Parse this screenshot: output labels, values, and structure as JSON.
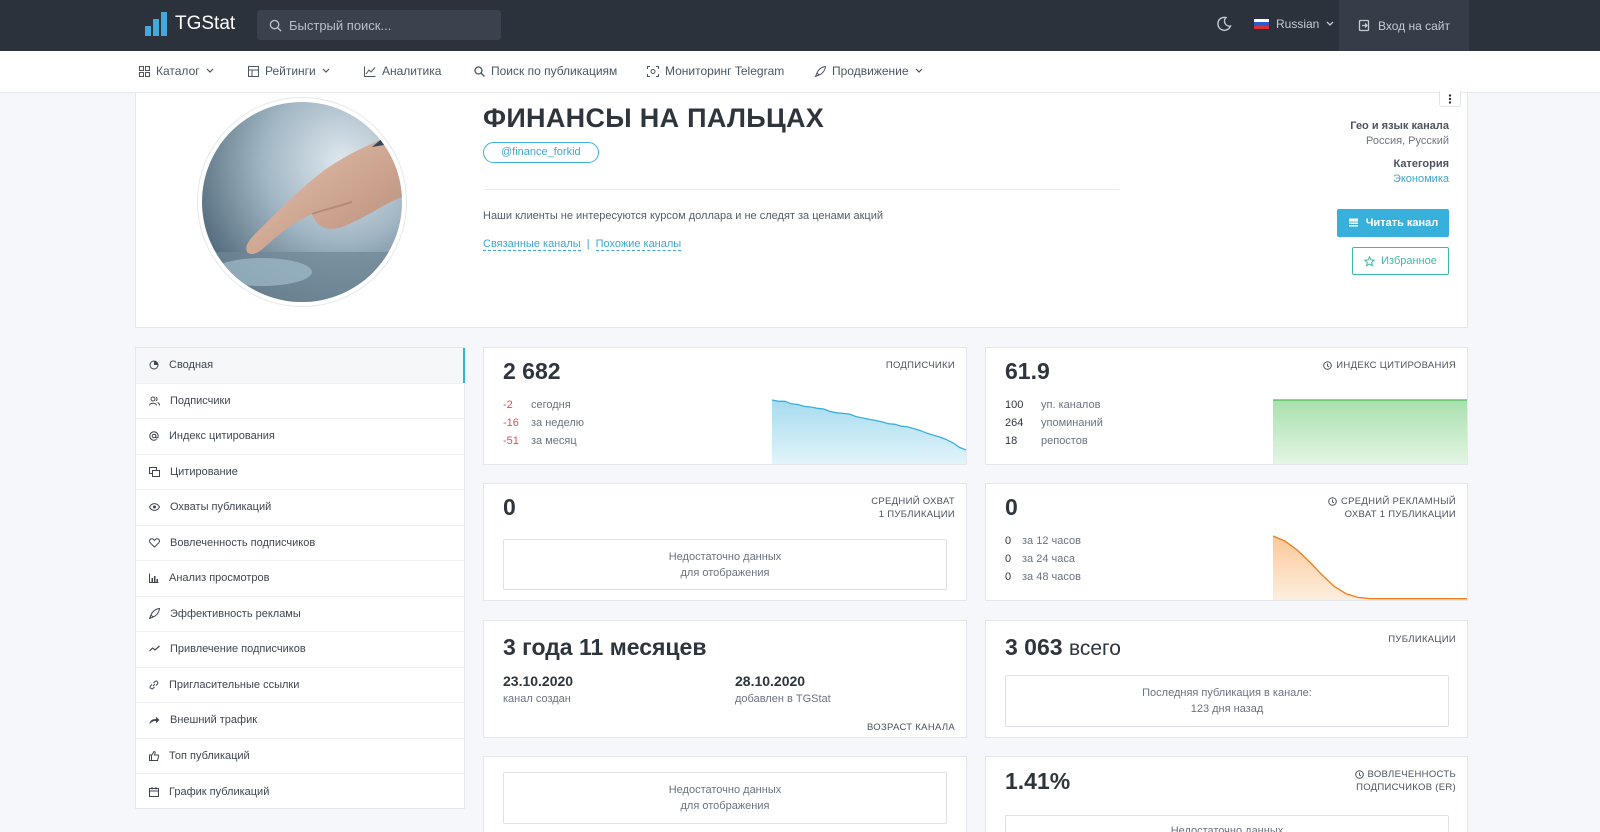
{
  "header": {
    "logo_text": "TGStat",
    "search_placeholder": "Быстрый поиск...",
    "language": "Russian",
    "login_label": "Вход на сайт"
  },
  "nav": [
    {
      "label": "Каталог",
      "icon": "grid-icon",
      "dropdown": true
    },
    {
      "label": "Рейтинги",
      "icon": "table-icon",
      "dropdown": true
    },
    {
      "label": "Аналитика",
      "icon": "chart-line-icon",
      "dropdown": false
    },
    {
      "label": "Поиск по публикациям",
      "icon": "search-icon",
      "dropdown": false
    },
    {
      "label": "Мониторинг Telegram",
      "icon": "monitor-icon",
      "dropdown": false
    },
    {
      "label": "Продвижение",
      "icon": "rocket-icon",
      "dropdown": true
    }
  ],
  "channel": {
    "title": "ФИНАНСЫ НА ПАЛЬЦАХ",
    "handle": "@finance_forkid",
    "description": "Наши клиенты не интересуются курсом доллара и не следят за ценами акций",
    "related_link": "Связанные каналы",
    "separator": "|",
    "similar_link": "Похожие каналы",
    "geo_label": "Гео и язык канала",
    "geo_value": "Россия, Русский",
    "category_label": "Категория",
    "category_value": "Экономика",
    "read_button": "Читать канал",
    "favorite_button": "Избранное"
  },
  "sidebar": [
    {
      "label": "Сводная",
      "icon": "summary-icon",
      "active": true
    },
    {
      "label": "Подписчики",
      "icon": "users-icon"
    },
    {
      "label": "Индекс цитирования",
      "icon": "at-icon"
    },
    {
      "label": "Цитирование",
      "icon": "quote-icon"
    },
    {
      "label": "Охваты публикаций",
      "icon": "eye-icon"
    },
    {
      "label": "Вовлеченность подписчиков",
      "icon": "heart-icon"
    },
    {
      "label": "Анализ просмотров",
      "icon": "bar-chart-icon"
    },
    {
      "label": "Эффективность рекламы",
      "icon": "rocket-icon"
    },
    {
      "label": "Привлечение подписчиков",
      "icon": "trend-icon"
    },
    {
      "label": "Пригласительные ссылки",
      "icon": "link-icon"
    },
    {
      "label": "Внешний трафик",
      "icon": "share-icon"
    },
    {
      "label": "Топ публикаций",
      "icon": "thumb-icon"
    },
    {
      "label": "График публикаций",
      "icon": "calendar-icon"
    }
  ],
  "stats": {
    "subscribers": {
      "value": "2 682",
      "label": "ПОДПИСЧИКИ",
      "rows": [
        {
          "n": "-2",
          "t": "сегодня"
        },
        {
          "n": "-16",
          "t": "за неделю"
        },
        {
          "n": "-51",
          "t": "за месяц"
        }
      ],
      "sparkline": [
        100,
        98,
        98,
        94,
        93,
        90,
        89,
        87,
        86,
        82,
        80,
        79,
        78,
        74,
        72,
        70,
        68,
        66,
        63,
        62,
        59,
        58,
        55,
        52,
        48,
        45,
        42,
        38,
        33,
        26,
        22
      ]
    },
    "citation": {
      "value": "61.9",
      "label": "ИНДЕКС ЦИТИРОВАНИЯ",
      "rows": [
        {
          "n": "100",
          "t": "уп. каналов"
        },
        {
          "n": "264",
          "t": "упоминаний"
        },
        {
          "n": "18",
          "t": "репостов"
        }
      ],
      "sparkline": [
        100,
        100,
        100,
        100,
        100,
        100,
        100,
        100,
        100,
        100,
        100,
        100
      ]
    },
    "avg_reach": {
      "value": "0",
      "label_line1": "СРЕДНИЙ ОХВАТ",
      "label_line2": "1 ПУБЛИКАЦИИ",
      "nodata_line1": "Недостаточно данных",
      "nodata_line2": "для отображения"
    },
    "ad_reach": {
      "value": "0",
      "label_line1": "СРЕДНИЙ РЕКЛАМНЫЙ",
      "label_line2": "ОХВАТ 1 ПУБЛИКАЦИИ",
      "rows": [
        {
          "n": "0",
          "t": "за 12 часов"
        },
        {
          "n": "0",
          "t": "за 24 часа"
        },
        {
          "n": "0",
          "t": "за 48 часов"
        }
      ],
      "sparkline": [
        100,
        92,
        78,
        60,
        40,
        22,
        10,
        4,
        2,
        2,
        2,
        2,
        2,
        2,
        2,
        2,
        2
      ]
    },
    "age": {
      "value": "3 года 11 месяцев",
      "created_date": "23.10.2020",
      "created_label": "канал создан",
      "added_date": "28.10.2020",
      "added_label": "добавлен в TGStat",
      "label": "ВОЗРАСТ КАНАЛА"
    },
    "publications": {
      "value": "3 063",
      "value_suffix": "всего",
      "label": "ПУБЛИКАЦИИ",
      "last_line1": "Последняя публикация в канале:",
      "last_line2": "123 дня назад"
    },
    "bottom_left": {
      "nodata_line1": "Недостаточно данных",
      "nodata_line2": "для отображения"
    },
    "er": {
      "value": "1.41%",
      "label_line1": "ВОВЛЕЧЕННОСТЬ",
      "label_line2": "ПОДПИСЧИКОВ (ER)",
      "nodata_line1": "Недостаточно данных"
    }
  },
  "colors": {
    "accent": "#38b0dc",
    "negative": "#e34d4d",
    "green": "#4cbb5a",
    "orange": "#f07d1a"
  }
}
